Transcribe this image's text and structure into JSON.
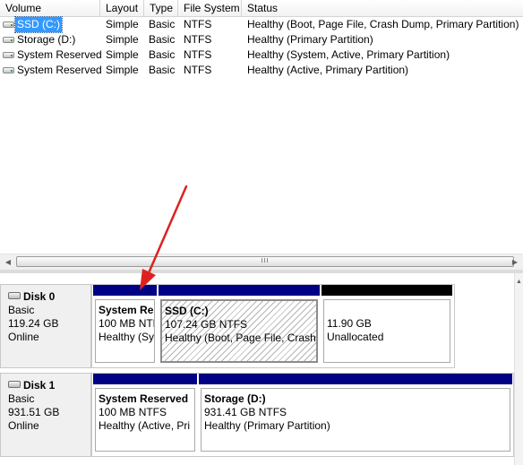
{
  "volume_list": {
    "columns": [
      "Volume",
      "Layout",
      "Type",
      "File System",
      "Status"
    ],
    "rows": [
      {
        "volume": "SSD (C:)",
        "layout": "Simple",
        "type": "Basic",
        "fs": "NTFS",
        "status": "Healthy (Boot, Page File, Crash Dump, Primary Partition)"
      },
      {
        "volume": "Storage (D:)",
        "layout": "Simple",
        "type": "Basic",
        "fs": "NTFS",
        "status": "Healthy (Primary Partition)"
      },
      {
        "volume": "System Reserved",
        "layout": "Simple",
        "type": "Basic",
        "fs": "NTFS",
        "status": "Healthy (System, Active, Primary Partition)"
      },
      {
        "volume": "System Reserved",
        "layout": "Simple",
        "type": "Basic",
        "fs": "NTFS",
        "status": "Healthy (Active, Primary Partition)"
      }
    ]
  },
  "scrollbar": {
    "grip": "III",
    "left_icon": "triangle-left-icon",
    "right_icon": "triangle-right-icon"
  },
  "disks": [
    {
      "name": "Disk 0",
      "type": "Basic",
      "size": "119.24 GB",
      "state": "Online",
      "partitions": [
        {
          "name": "System Re",
          "size": "100 MB NTF",
          "status": "Healthy (Sy"
        },
        {
          "name": "SSD  (C:)",
          "size": "107.24 GB NTFS",
          "status": "Healthy (Boot, Page File, Crash"
        },
        {
          "name": "",
          "size": "11.90 GB",
          "status": "Unallocated"
        }
      ]
    },
    {
      "name": "Disk 1",
      "type": "Basic",
      "size": "931.51 GB",
      "state": "Online",
      "partitions": [
        {
          "name": "System Reserved",
          "size": "100 MB NTFS",
          "status": "Healthy (Active, Pri"
        },
        {
          "name": "Storage  (D:)",
          "size": "931.41 GB NTFS",
          "status": "Healthy (Primary Partition)"
        }
      ]
    }
  ],
  "colors": {
    "primary_partition": "#000084",
    "unallocated": "#000000",
    "annotation_arrow": "#e02020",
    "selection": "#3399ff"
  }
}
